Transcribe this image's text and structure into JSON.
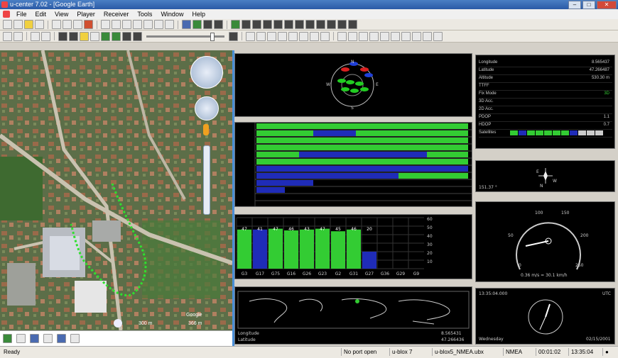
{
  "window": {
    "title": "u-center 7.02 - [Google Earth]"
  },
  "menu": [
    "File",
    "Edit",
    "View",
    "Player",
    "Receiver",
    "Tools",
    "Window",
    "Help"
  ],
  "map": {
    "scale_text": "300 m",
    "attribution": "Google",
    "altitude": "366 m"
  },
  "sky_view": {
    "labels": {
      "n": "N",
      "s": "S",
      "e": "E",
      "w": "W"
    }
  },
  "bar_chart": {
    "sat_labels": [
      "G3",
      "G17",
      "G75",
      "G16",
      "G26",
      "G23",
      "G2",
      "G31",
      "G27",
      "G36",
      "G29",
      "G9"
    ],
    "values": [
      46,
      46,
      47,
      45,
      46,
      47,
      44,
      46,
      20,
      0,
      0,
      0
    ],
    "value_labels": [
      "47",
      "41",
      "47",
      "46",
      "43",
      "47",
      "45",
      "46",
      "20",
      "",
      "",
      ""
    ],
    "ticks": [
      "60",
      "50",
      "40",
      "30",
      "20",
      "10"
    ],
    "colors": {
      "tracked": "#33cc33",
      "used": "#1f2cb8"
    }
  },
  "data_view": {
    "rows": [
      {
        "k": "Longitude",
        "v": "8.565437"
      },
      {
        "k": "Latitude",
        "v": "47.266487"
      },
      {
        "k": "Altitude",
        "v": "530.30 m"
      },
      {
        "k": "TTFF",
        "v": ""
      },
      {
        "k": "Fix Mode",
        "v": "3D"
      },
      {
        "k": "3D Acc.",
        "v": ""
      },
      {
        "k": "2D Acc.",
        "v": ""
      },
      {
        "k": "PDOP",
        "v": "1.1"
      },
      {
        "k": "HDOP",
        "v": "0.7"
      },
      {
        "k": "Satellites",
        "v": ""
      }
    ],
    "pdop_range": [
      "0",
      "10"
    ],
    "hdop_range": [
      "0",
      "10"
    ]
  },
  "compass": {
    "value": "151.37 °",
    "labels": [
      "E",
      "W",
      "N"
    ]
  },
  "speedometer": {
    "ticks": [
      "50",
      "100",
      "150",
      "200",
      "250",
      "0"
    ],
    "readout": "0.36 m/s = 30.1 km/h"
  },
  "clock": {
    "time": "13:35:04.000",
    "zone": "UTC",
    "weekday": "Wednesday",
    "date": "02/15/2001"
  },
  "world_map": {
    "rows": [
      {
        "k": "Longitude",
        "v": "8.565431"
      },
      {
        "k": "Latitude",
        "v": "47.266436"
      }
    ]
  },
  "status": {
    "ready": "Ready",
    "port": "No port open",
    "receiver": "u-blox 7",
    "file": "u-blox5_NMEA.ubx",
    "protocol": "NMEA",
    "elapsed": "00:01:02",
    "clock": "13:35:04"
  }
}
